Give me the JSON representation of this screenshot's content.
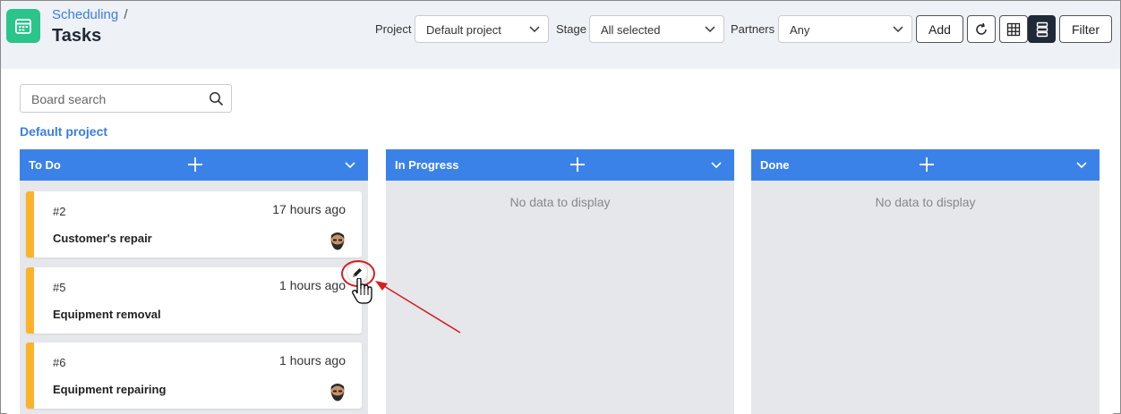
{
  "header": {
    "breadcrumb": "Scheduling",
    "breadcrumb_sep": "/",
    "title": "Tasks",
    "app_icon": "calendar-icon"
  },
  "filters": {
    "project_label": "Project",
    "project_value": "Default project",
    "stage_label": "Stage",
    "stage_value": "All selected",
    "partners_label": "Partners",
    "partners_value": "Any"
  },
  "toolbar": {
    "add_label": "Add",
    "filter_label": "Filter",
    "icons": [
      "refresh-icon",
      "grid-view-icon",
      "list-view-icon"
    ]
  },
  "board": {
    "search_placeholder": "Board search",
    "project_name": "Default project",
    "columns": [
      {
        "title": "To Do",
        "empty_text": "",
        "cards": [
          {
            "number": "#2",
            "time": "17 hours ago",
            "title": "Customer's repair",
            "has_avatar": true
          },
          {
            "number": "#5",
            "time": "1 hours ago",
            "title": "Equipment removal",
            "has_avatar": false
          },
          {
            "number": "#6",
            "time": "1 hours ago",
            "title": "Equipment repairing",
            "has_avatar": true
          }
        ]
      },
      {
        "title": "In Progress",
        "empty_text": "No data to display",
        "cards": []
      },
      {
        "title": "Done",
        "empty_text": "No data to display",
        "cards": []
      }
    ]
  },
  "colors": {
    "accent": "#3b82e8",
    "brand": "#2bc48a",
    "card_stripe": "#fbb32a",
    "annotation": "#d42020"
  }
}
